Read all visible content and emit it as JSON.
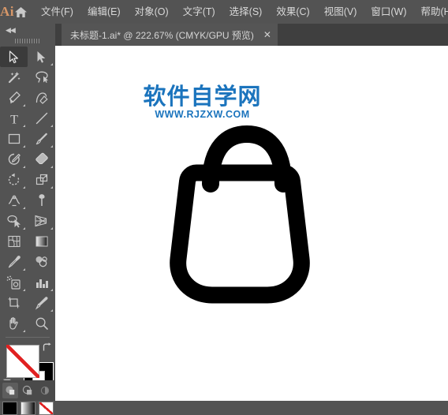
{
  "app": {
    "logo_text": "Ai",
    "home_icon": "home-icon"
  },
  "menubar": {
    "items": [
      {
        "label": "文件(F)"
      },
      {
        "label": "编辑(E)"
      },
      {
        "label": "对象(O)"
      },
      {
        "label": "文字(T)"
      },
      {
        "label": "选择(S)"
      },
      {
        "label": "效果(C)"
      },
      {
        "label": "视图(V)"
      },
      {
        "label": "窗口(W)"
      },
      {
        "label": "帮助(H"
      }
    ]
  },
  "document_tab": {
    "title": "未标题-1.ai* @ 222.67% (CMYK/GPU 预览)",
    "close_label": "✕",
    "zoom_level": "222.67%",
    "color_mode": "CMYK/GPU 预览",
    "file_name": "未标题-1.ai*",
    "modified": true
  },
  "toolbar": {
    "collapse_label": "◀◀",
    "tools": [
      {
        "name": "selection-tool",
        "active": true,
        "has_flyout": false
      },
      {
        "name": "direct-selection-tool",
        "active": false,
        "has_flyout": true
      },
      {
        "name": "magic-wand-tool",
        "active": false,
        "has_flyout": false
      },
      {
        "name": "lasso-tool",
        "active": false,
        "has_flyout": false
      },
      {
        "name": "pen-tool",
        "active": false,
        "has_flyout": true
      },
      {
        "name": "curvature-tool",
        "active": false,
        "has_flyout": false
      },
      {
        "name": "type-tool",
        "active": false,
        "has_flyout": true
      },
      {
        "name": "line-segment-tool",
        "active": false,
        "has_flyout": true
      },
      {
        "name": "rectangle-tool",
        "active": false,
        "has_flyout": true
      },
      {
        "name": "paintbrush-tool",
        "active": false,
        "has_flyout": true
      },
      {
        "name": "shaper-tool",
        "active": false,
        "has_flyout": true
      },
      {
        "name": "eraser-tool",
        "active": false,
        "has_flyout": true
      },
      {
        "name": "rotate-tool",
        "active": false,
        "has_flyout": true
      },
      {
        "name": "scale-tool",
        "active": false,
        "has_flyout": true
      },
      {
        "name": "width-tool",
        "active": false,
        "has_flyout": true
      },
      {
        "name": "free-transform-tool",
        "active": false,
        "has_flyout": false
      },
      {
        "name": "shape-builder-tool",
        "active": false,
        "has_flyout": true
      },
      {
        "name": "perspective-grid-tool",
        "active": false,
        "has_flyout": true
      },
      {
        "name": "mesh-tool",
        "active": false,
        "has_flyout": false
      },
      {
        "name": "gradient-tool",
        "active": false,
        "has_flyout": false
      },
      {
        "name": "eyedropper-tool",
        "active": false,
        "has_flyout": true
      },
      {
        "name": "blend-tool",
        "active": false,
        "has_flyout": false
      },
      {
        "name": "symbol-sprayer-tool",
        "active": false,
        "has_flyout": true
      },
      {
        "name": "column-graph-tool",
        "active": false,
        "has_flyout": true
      },
      {
        "name": "artboard-tool",
        "active": false,
        "has_flyout": false
      },
      {
        "name": "slice-tool",
        "active": false,
        "has_flyout": true
      },
      {
        "name": "hand-tool",
        "active": false,
        "has_flyout": true
      },
      {
        "name": "zoom-tool",
        "active": false,
        "has_flyout": false
      }
    ],
    "fill": {
      "label": "填色",
      "value": "none"
    },
    "stroke": {
      "label": "描边",
      "value": "#000000"
    },
    "color_modes": [
      {
        "name": "color-mode",
        "label": "颜色"
      },
      {
        "name": "gradient-mode",
        "label": "渐变"
      },
      {
        "name": "none-mode",
        "label": "无"
      }
    ],
    "draw_modes": [
      {
        "name": "draw-normal",
        "label": "正常绘图",
        "active": true
      },
      {
        "name": "draw-behind",
        "label": "背面绘图",
        "active": false
      },
      {
        "name": "draw-inside",
        "label": "内部绘图",
        "active": false
      }
    ]
  },
  "watermark": {
    "line1": "软件自学网",
    "line2": "WWW.RJZXW.COM"
  },
  "artwork": {
    "name": "handbag-shape",
    "description": "手提包图标",
    "stroke_color": "#000000",
    "fill_color": "none"
  },
  "colors": {
    "chrome": "#535353",
    "tabbar": "#3f3f3f",
    "tab_active": "#555555",
    "canvas": "#ffffff",
    "accent": "#d79768",
    "watermark": "#1b74bd",
    "text": "#d8d8d8"
  }
}
